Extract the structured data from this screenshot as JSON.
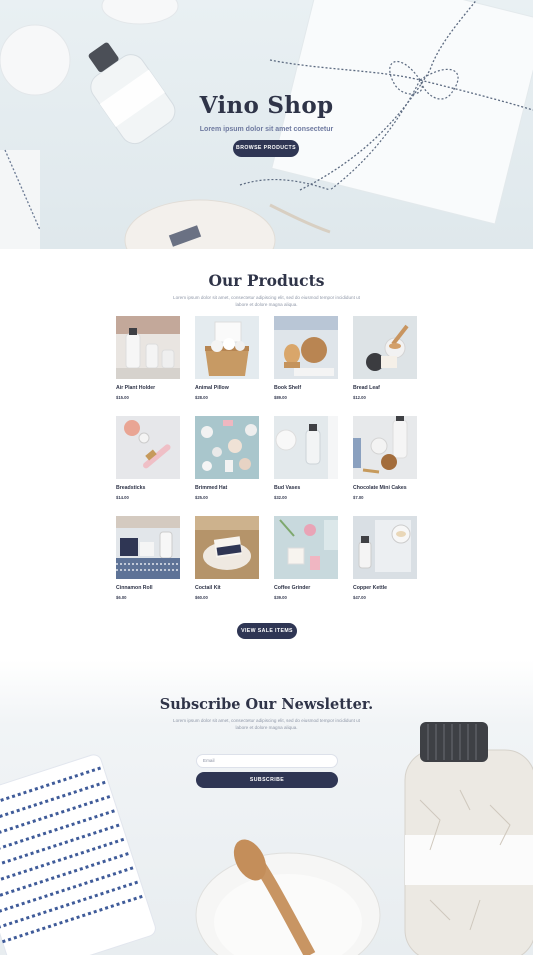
{
  "hero": {
    "title": "Vino Shop",
    "subtitle": "Lorem ipsum dolor sit amet consectetur",
    "button": "BROWSE PRODUCTS"
  },
  "products": {
    "title": "Our Products",
    "description": "Lorem ipsum dolor sit amet, consectetur adipiscing elit, sed do eiusmod tempor incididunt ut labore et dolore magna aliqua.",
    "items": [
      {
        "name": "Air Plant Holder",
        "price": "$15.00"
      },
      {
        "name": "Animal Pillow",
        "price": "$28.00"
      },
      {
        "name": "Book Shelf",
        "price": "$89.00"
      },
      {
        "name": "Bread Leaf",
        "price": "$12.00"
      },
      {
        "name": "Breadsticks",
        "price": "$14.00"
      },
      {
        "name": "Brimmed Hat",
        "price": "$25.00"
      },
      {
        "name": "Bud Vases",
        "price": "$32.00"
      },
      {
        "name": "Chocolate Mini Cakes",
        "price": "$7.00"
      },
      {
        "name": "Cinnamon Roll",
        "price": "$6.00"
      },
      {
        "name": "Coctail Kit",
        "price": "$60.00"
      },
      {
        "name": "Coffee Grinder",
        "price": "$39.00"
      },
      {
        "name": "Copper Kettle",
        "price": "$47.00"
      }
    ],
    "sale_button": "VIEW SALE ITEMS"
  },
  "newsletter": {
    "title": "Subscribe Our Newsletter.",
    "description": "Lorem ipsum dolor sit amet, consectetur adipiscing elit, sed do eiusmod tempor incididunt ut labore et dolore magna aliqua.",
    "email_placeholder": "Email",
    "button": "SUBSCRIBE"
  },
  "colors": {
    "accent": "#2f3654",
    "heading": "#2f3448",
    "body_text": "#9098a8"
  }
}
